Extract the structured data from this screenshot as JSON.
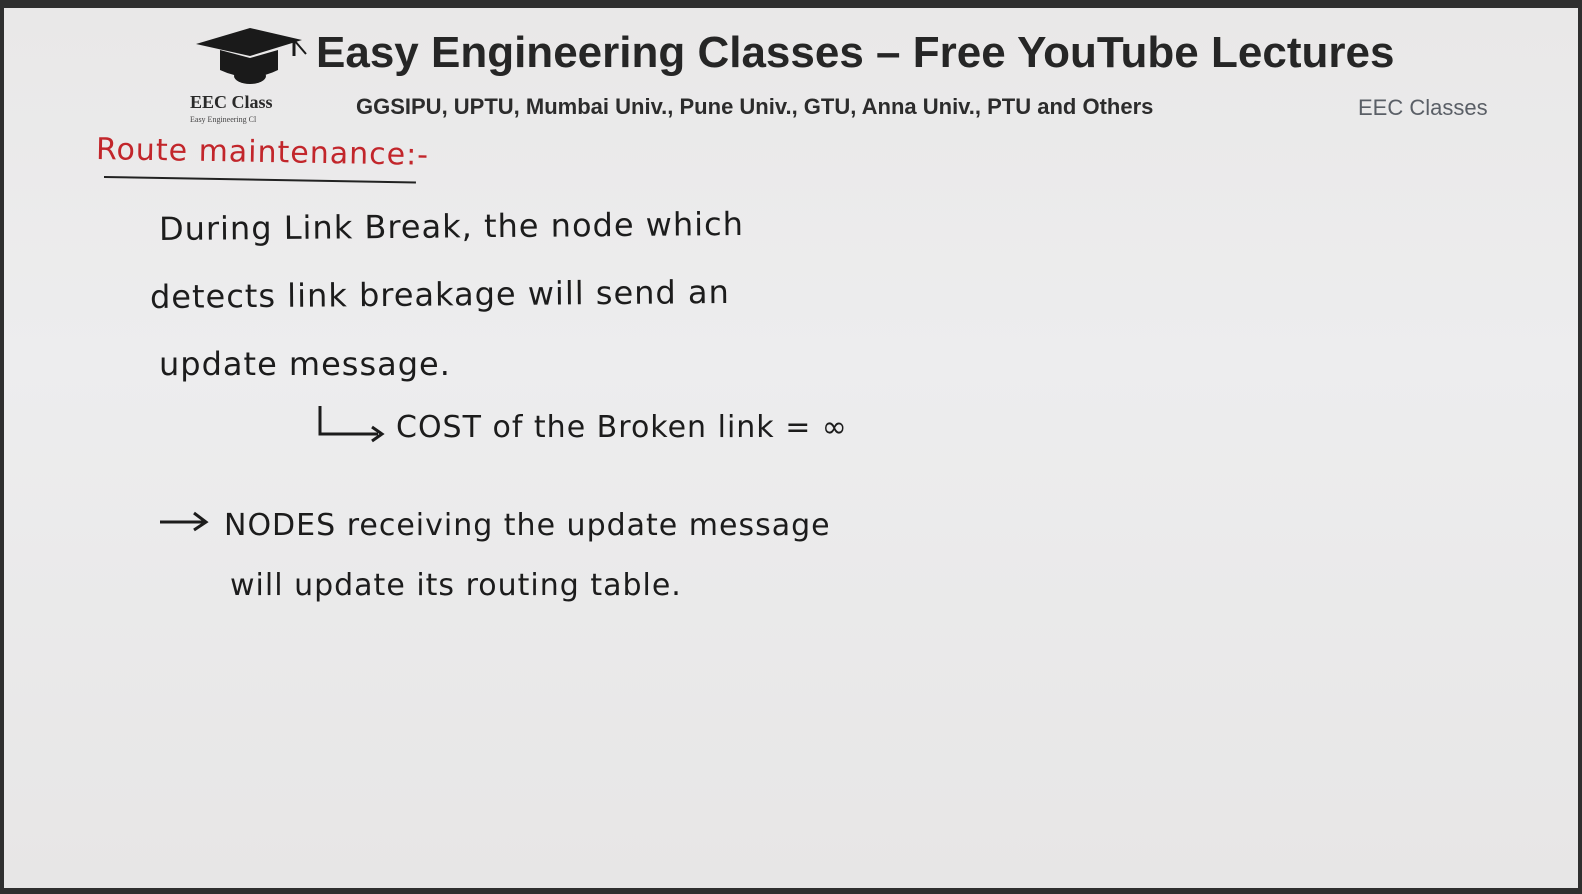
{
  "header": {
    "title": "Easy Engineering Classes – Free YouTube Lectures",
    "subtitle": "GGSIPU, UPTU, Mumbai Univ., Pune Univ., GTU, Anna Univ., PTU and Others",
    "channel": "EEC Classes",
    "logo": {
      "icon": "graduation-cap-icon",
      "name": "EEC Class",
      "tagline": "Easy Engineering Cl"
    }
  },
  "notes": {
    "title": "Route maintenance:-",
    "paragraph_lines": [
      "During Link Break, the node which",
      "detects link breakage will send an",
      "update message."
    ],
    "sub_point": "COST of the Broken link = ∞",
    "bullet_lines": [
      "NODES receiving the update message",
      "will update its routing table."
    ]
  },
  "colors": {
    "background": "#ececec",
    "ink": "#1c1c1c",
    "title_ink": "#c2262b"
  }
}
